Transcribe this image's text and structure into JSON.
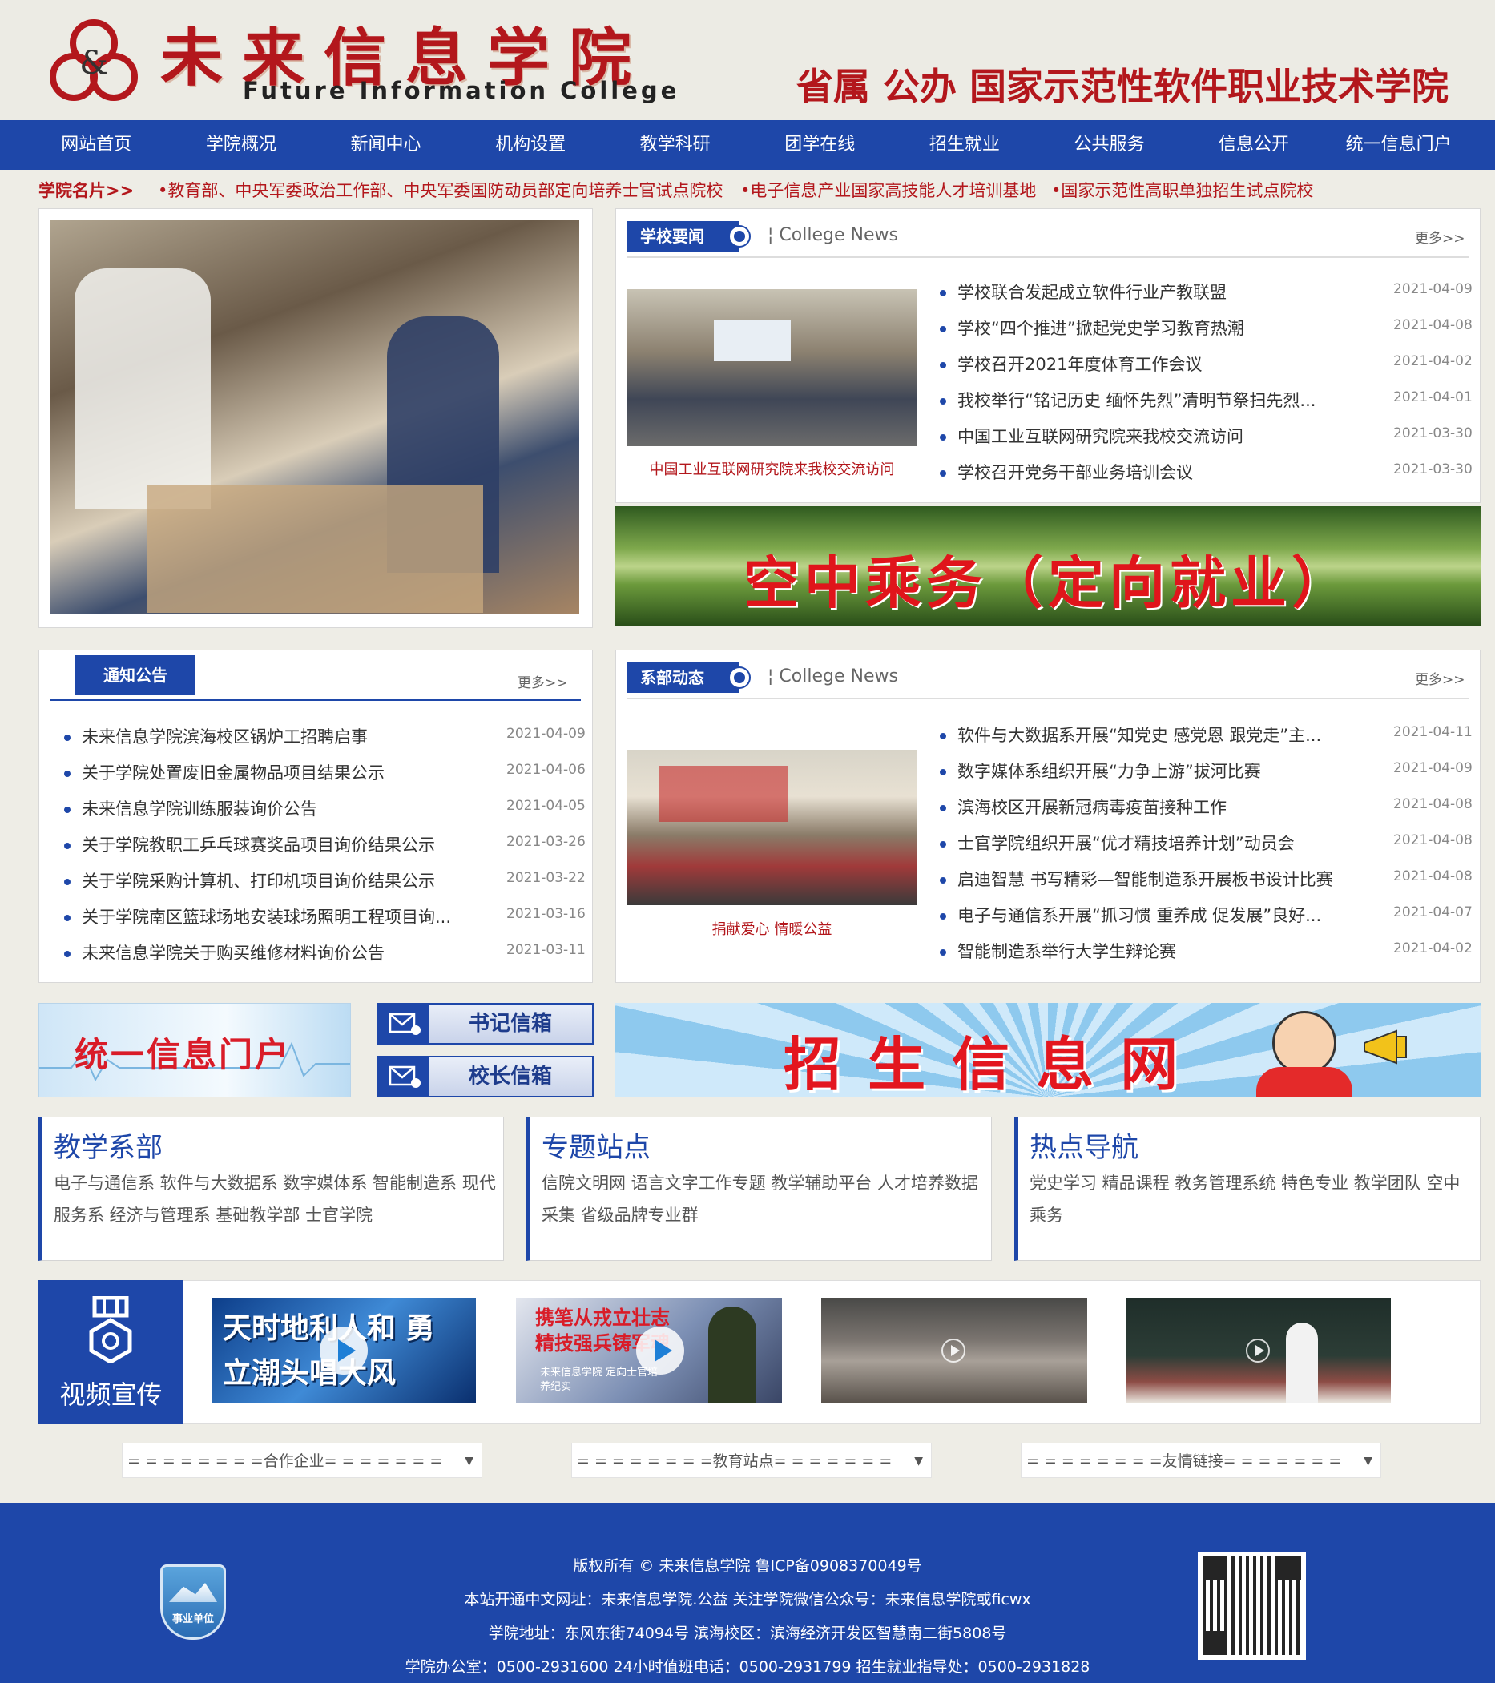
{
  "header": {
    "title_cn": "未来信息学院",
    "title_en": "Future Information College",
    "slogan": "省属 公办 国家示范性软件职业技术学院",
    "logo_glyph": "&"
  },
  "nav": [
    "网站首页",
    "学院概况",
    "新闻中心",
    "机构设置",
    "教学科研",
    "团学在线",
    "招生就业",
    "公共服务",
    "信息公开",
    "统一信息门户"
  ],
  "ticker": {
    "label": "学院名片>>",
    "items": [
      "•教育部、中央军委政治工作部、中央军委国防动员部定向培养士官试点院校",
      "•电子信息产业国家高技能人才培训基地",
      "•国家示范性高职单独招生试点院校"
    ]
  },
  "school_news": {
    "tab": "学校要闻",
    "en": "College News",
    "more": "更多>>",
    "caption": "中国工业互联网研究院来我校交流访问",
    "items": [
      {
        "title": "学校联合发起成立软件行业产教联盟",
        "date": "2021-04-09"
      },
      {
        "title": "学校“四个推进”掀起党史学习教育热潮",
        "date": "2021-04-08"
      },
      {
        "title": "学校召开2021年度体育工作会议",
        "date": "2021-04-02"
      },
      {
        "title": "我校举行“铭记历史 缅怀先烈”清明节祭扫先烈...",
        "date": "2021-04-01"
      },
      {
        "title": "中国工业互联网研究院来我校交流访问",
        "date": "2021-03-30"
      },
      {
        "title": "学校召开党务干部业务培训会议",
        "date": "2021-03-30"
      }
    ]
  },
  "banner_air": "空中乘务（定向就业）",
  "notices": {
    "tab": "通知公告",
    "more": "更多>>",
    "items": [
      {
        "title": "未来信息学院滨海校区锅炉工招聘启事",
        "date": "2021-04-09"
      },
      {
        "title": "关于学院处置废旧金属物品项目结果公示",
        "date": "2021-04-06"
      },
      {
        "title": "未来信息学院训练服装询价公告",
        "date": "2021-04-05"
      },
      {
        "title": "关于学院教职工乒乓球赛奖品项目询价结果公示",
        "date": "2021-03-26"
      },
      {
        "title": "关于学院采购计算机、打印机项目询价结果公示",
        "date": "2021-03-22"
      },
      {
        "title": "关于学院南区篮球场地安装球场照明工程项目询...",
        "date": "2021-03-16"
      },
      {
        "title": "未来信息学院关于购买维修材料询价公告",
        "date": "2021-03-11"
      }
    ]
  },
  "dept_news": {
    "tab": "系部动态",
    "en": "College News",
    "more": "更多>>",
    "caption": "捐献爱心 情暖公益",
    "items": [
      {
        "title": "软件与大数据系开展“知党史 感党恩 跟党走”主...",
        "date": "2021-04-11"
      },
      {
        "title": "数字媒体系组织开展“力争上游”拔河比赛",
        "date": "2021-04-09"
      },
      {
        "title": "滨海校区开展新冠病毒疫苗接种工作",
        "date": "2021-04-08"
      },
      {
        "title": "士官学院组织开展“优才精技培养计划”动员会",
        "date": "2021-04-08"
      },
      {
        "title": "启迪智慧 书写精彩—智能制造系开展板书设计比赛",
        "date": "2021-04-08"
      },
      {
        "title": "电子与通信系开展“抓习惯 重养成 促发展”良好...",
        "date": "2021-04-07"
      },
      {
        "title": "智能制造系举行大学生辩论赛",
        "date": "2021-04-02"
      }
    ]
  },
  "banners": {
    "portal": "统一信息门户",
    "secretary": "书记信箱",
    "president": "校长信箱",
    "admission": "招 生 信 息 网"
  },
  "link_boxes": [
    {
      "title": "教学系部",
      "body": "电子与通信系 软件与大数据系 数字媒体系 智能制造系 现代服务系 经济与管理系 基础教学部 士官学院"
    },
    {
      "title": "专题站点",
      "body": "信院文明网 语言文字工作专题 教学辅助平台 人才培养数据采集 省级品牌专业群"
    },
    {
      "title": "热点导航",
      "body": "党史学习 精品课程 教务管理系统 特色专业 教学团队 空中乘务"
    }
  ],
  "video": {
    "label": "视频宣传",
    "thumbs": [
      {
        "text": "天时地利人和 勇立潮头唱大风"
      },
      {
        "text": "携笔从戎立壮志 精技强兵铸军魂",
        "sub": "未来信息学院 定向士官培养纪实"
      },
      {
        "text": ""
      },
      {
        "text": ""
      }
    ]
  },
  "selects": [
    "= = = = = = = =合作企业= = = = = = =",
    "= = = = = = = =教育站点= = = = = = =",
    "= = = = = = = =友情链接= = = = = = ="
  ],
  "footer": {
    "lines": [
      "版权所有 © 未来信息学院 鲁ICP备0908370049号",
      "本站开通中文网址：未来信息学院.公益 关注学院微信公众号：未来信息学院或ficwx",
      "学院地址：东风东街74094号  滨海校区：滨海经济开发区智慧南二街5808号",
      "学院办公室：0500-2931600 24小时值班电话：0500-2931799 招生就业指导处：0500-2931828"
    ],
    "badge": "事业单位"
  }
}
